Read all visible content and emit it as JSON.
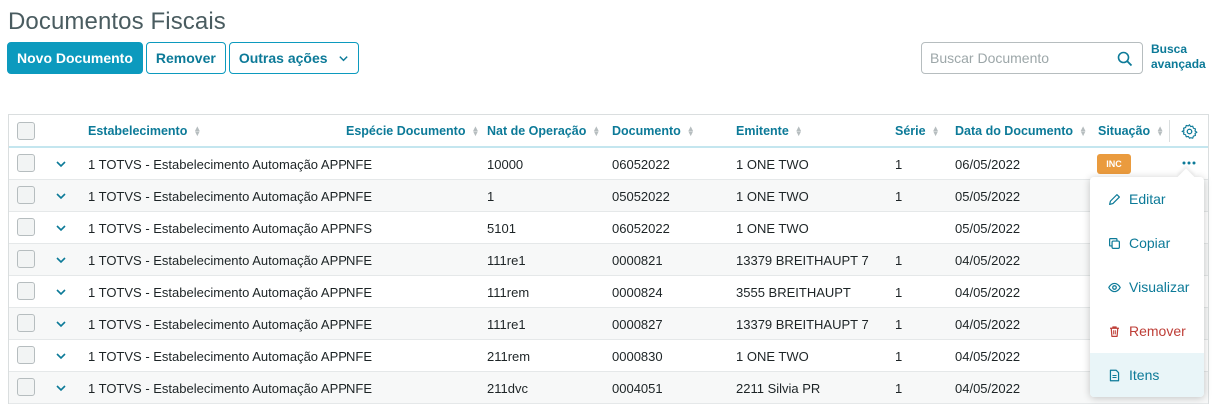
{
  "page": {
    "title": "Documentos Fiscais"
  },
  "toolbar": {
    "new_label": "Novo Documento",
    "remove_label": "Remover",
    "more_actions_label": "Outras ações"
  },
  "search": {
    "placeholder": "Buscar Documento",
    "advanced_line1": "Busca",
    "advanced_line2": "avançada"
  },
  "table": {
    "columns": [
      "Estabelecimento",
      "Espécie Documento",
      "Nat de Operação",
      "Documento",
      "Emitente",
      "Série",
      "Data do Documento",
      "Situação"
    ],
    "rows": [
      {
        "estabelecimento": "1 TOTVS - Estabelecimento Automação APP",
        "especie": "NFE",
        "nat_operacao": "10000",
        "documento": "06052022",
        "emitente": "1 ONE TWO",
        "serie": "1",
        "data": "06/05/2022",
        "situacao": "INC"
      },
      {
        "estabelecimento": "1 TOTVS - Estabelecimento Automação APP",
        "especie": "NFE",
        "nat_operacao": "1",
        "documento": "05052022",
        "emitente": "1 ONE TWO",
        "serie": "1",
        "data": "05/05/2022",
        "situacao": ""
      },
      {
        "estabelecimento": "1 TOTVS - Estabelecimento Automação APP",
        "especie": "NFS",
        "nat_operacao": "5101",
        "documento": "06052022",
        "emitente": "1 ONE TWO",
        "serie": "",
        "data": "05/05/2022",
        "situacao": ""
      },
      {
        "estabelecimento": "1 TOTVS - Estabelecimento Automação APP",
        "especie": "NFE",
        "nat_operacao": "111re1",
        "documento": "0000821",
        "emitente": "13379 BREITHAUPT 7",
        "serie": "1",
        "data": "04/05/2022",
        "situacao": ""
      },
      {
        "estabelecimento": "1 TOTVS - Estabelecimento Automação APP",
        "especie": "NFE",
        "nat_operacao": "111rem",
        "documento": "0000824",
        "emitente": "3555 BREITHAUPT",
        "serie": "1",
        "data": "04/05/2022",
        "situacao": ""
      },
      {
        "estabelecimento": "1 TOTVS - Estabelecimento Automação APP",
        "especie": "NFE",
        "nat_operacao": "111re1",
        "documento": "0000827",
        "emitente": "13379 BREITHAUPT 7",
        "serie": "1",
        "data": "04/05/2022",
        "situacao": ""
      },
      {
        "estabelecimento": "1 TOTVS - Estabelecimento Automação APP",
        "especie": "NFE",
        "nat_operacao": "211rem",
        "documento": "0000830",
        "emitente": "1 ONE TWO",
        "serie": "1",
        "data": "04/05/2022",
        "situacao": ""
      },
      {
        "estabelecimento": "1 TOTVS - Estabelecimento Automação APP",
        "especie": "NFE",
        "nat_operacao": "211dvc",
        "documento": "0004051",
        "emitente": "2211 Silvia PR",
        "serie": "1",
        "data": "04/05/2022",
        "situacao": ""
      }
    ]
  },
  "row_menu": {
    "items": [
      {
        "label": "Editar",
        "icon": "pencil-icon"
      },
      {
        "label": "Copiar",
        "icon": "copy-icon"
      },
      {
        "label": "Visualizar",
        "icon": "eye-icon"
      },
      {
        "label": "Remover",
        "icon": "trash-icon"
      },
      {
        "label": "Itens",
        "icon": "document-icon"
      }
    ]
  },
  "colors": {
    "primary": "#0c9abe",
    "link": "#0c7a98",
    "badge_warning": "#ea9b3e",
    "danger": "#be3e37"
  }
}
